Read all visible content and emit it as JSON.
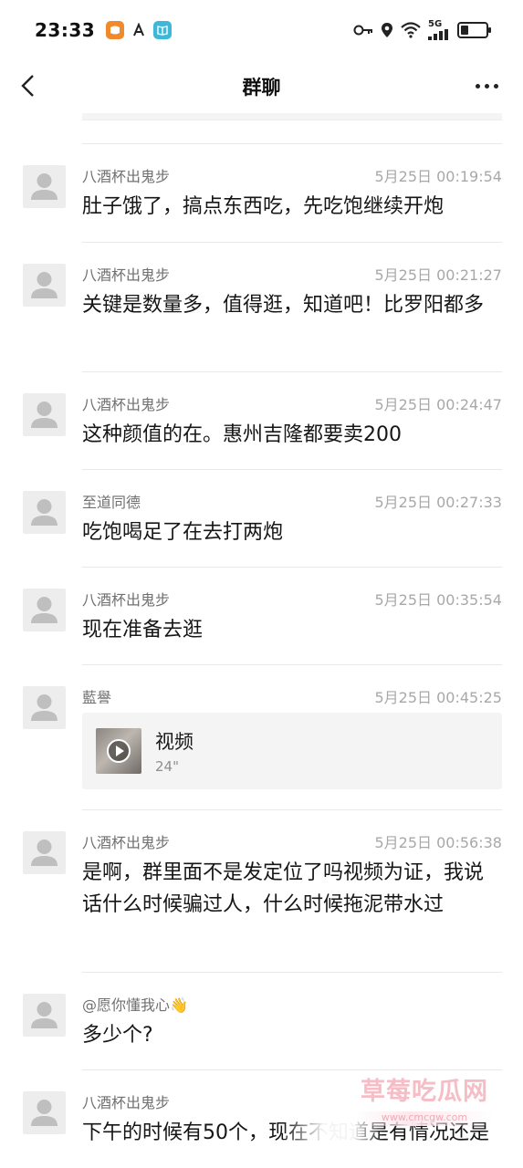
{
  "status_bar": {
    "time": "23:33",
    "network": "5G",
    "battery_level": 0.3,
    "app_icons": [
      "taobao-icon",
      "a-icon",
      "book-icon"
    ],
    "right_icons": [
      "key-icon",
      "location-icon",
      "wifi-icon",
      "signal-icon",
      "battery-icon"
    ]
  },
  "nav": {
    "title": "群聊",
    "back_icon": "chevron-left-icon",
    "more_icon": "more-dots-icon"
  },
  "messages": [
    {
      "sender": "八酒杯出鬼步",
      "time": "5月25日 00:19:54",
      "text": "肚子饿了，搞点东西吃，先吃饱继续开炮"
    },
    {
      "sender": "八酒杯出鬼步",
      "time": "5月25日 00:21:27",
      "text": "关键是数量多，值得逛，知道吧！比罗阳都多"
    },
    {
      "sender": "八酒杯出鬼步",
      "time": "5月25日 00:24:47",
      "text": "这种颜值的在。惠州吉隆都要卖200"
    },
    {
      "sender": "至道同德",
      "time": "5月25日 00:27:33",
      "text": "吃饱喝足了在去打两炮"
    },
    {
      "sender": "八酒杯出鬼步",
      "time": "5月25日 00:35:54",
      "text": "现在准备去逛"
    },
    {
      "sender": "藍譽",
      "time": "5月25日 00:45:25",
      "video": {
        "title": "视频",
        "duration": "24\""
      }
    },
    {
      "sender": "八酒杯出鬼步",
      "time": "5月25日 00:56:38",
      "text": "是啊，群里面不是发定位了吗视频为证，我说话什么时候骗过人，什么时候拖泥带水过"
    },
    {
      "sender": "@愿你懂我心👋",
      "time": "",
      "text": "多少个?"
    },
    {
      "sender": "八酒杯出鬼步",
      "time": "",
      "text": "下午的时候有50个，现在不知道是有情况还是"
    }
  ],
  "watermark": {
    "title": "草莓吃瓜网",
    "url": "www.cmcgw.com"
  },
  "colors": {
    "text_primary": "#161616",
    "text_secondary": "#707070",
    "timestamp": "#a8a8a8",
    "divider": "#e8e8e8",
    "avatar_bg": "#ededed",
    "watermark": "#f4b6c0"
  }
}
